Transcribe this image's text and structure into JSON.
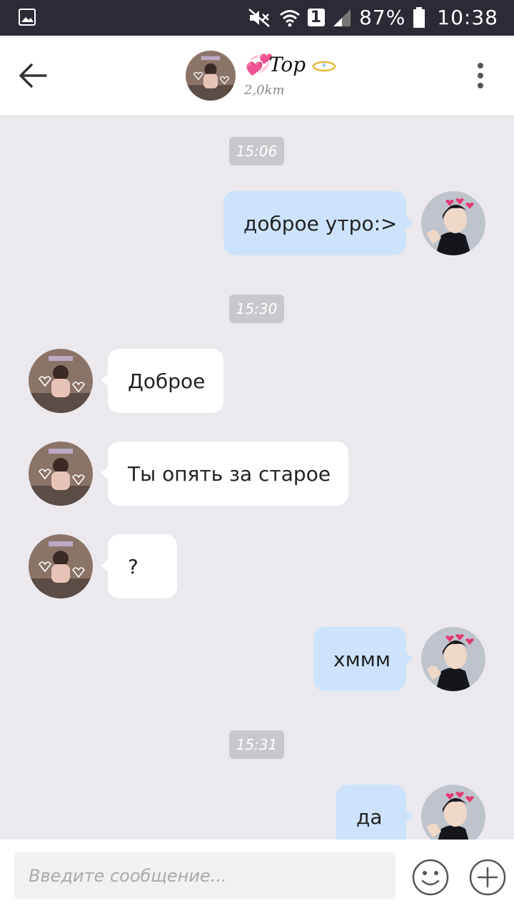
{
  "status_bar": {
    "battery_percent": "87%",
    "time": "10:38",
    "sim_label": "1"
  },
  "header": {
    "title": "💞Top",
    "distance": "2,0km"
  },
  "messages": [
    {
      "type": "timestamp",
      "text": "15:06"
    },
    {
      "type": "outgoing",
      "text": "доброе утро:>"
    },
    {
      "type": "timestamp",
      "text": "15:30"
    },
    {
      "type": "incoming",
      "text": "Доброе"
    },
    {
      "type": "incoming",
      "text": "Ты опять за старое"
    },
    {
      "type": "incoming",
      "text": "?"
    },
    {
      "type": "outgoing",
      "text": "хммм"
    },
    {
      "type": "timestamp",
      "text": "15:31"
    },
    {
      "type": "outgoing",
      "text": "да"
    }
  ],
  "input": {
    "placeholder": "Введите сообщение..."
  },
  "icons": {
    "back": "arrow-left-icon",
    "menu": "more-vert-icon",
    "emoji": "smiley-icon",
    "attach": "plus-icon"
  }
}
